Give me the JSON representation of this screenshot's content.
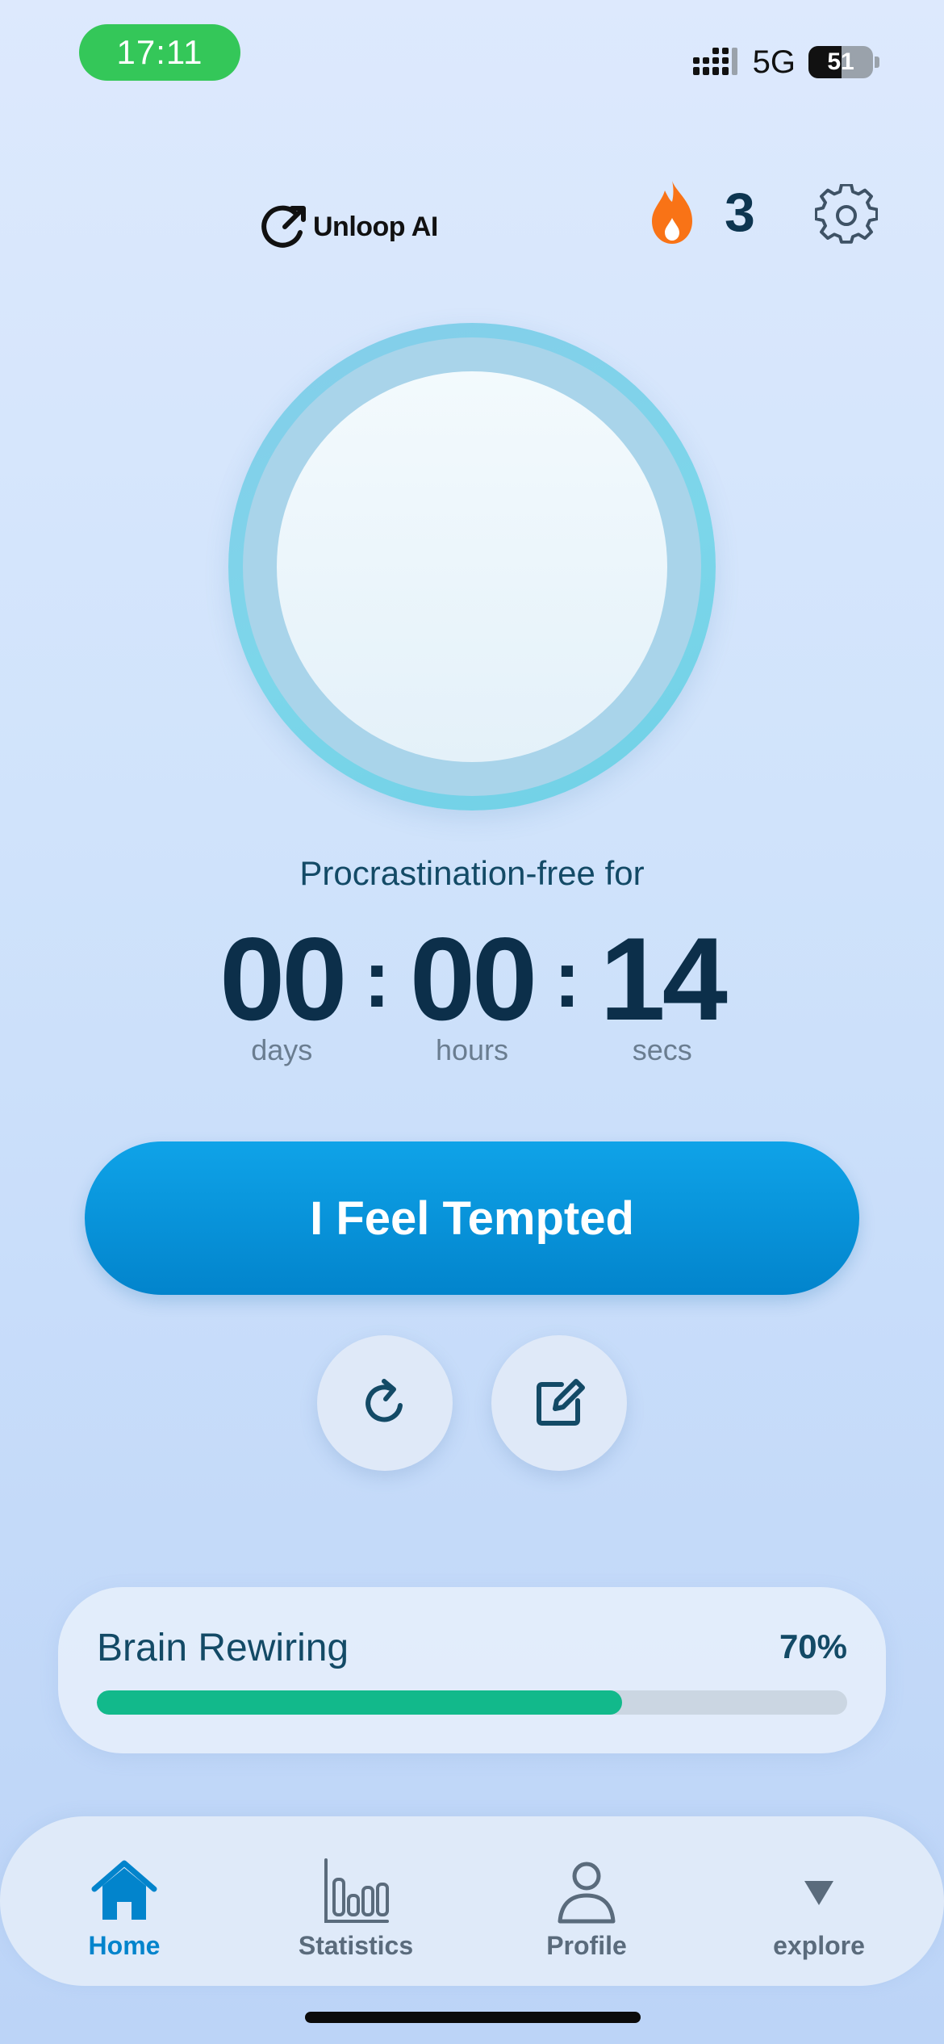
{
  "status_bar": {
    "time": "17:11",
    "network": "5G",
    "battery": "51"
  },
  "header": {
    "brand": "Unloop AI",
    "streak_count": "3"
  },
  "timer": {
    "subtitle": "Procrastination-free for",
    "days": "00",
    "hours": "00",
    "secs": "14",
    "days_label": "days",
    "hours_label": "hours",
    "secs_label": "secs",
    "separator": ":"
  },
  "actions": {
    "tempted_label": "I Feel Tempted"
  },
  "progress": {
    "title": "Brain Rewiring",
    "value_label": "70%",
    "fraction": 0.7,
    "color": "#12b98b"
  },
  "nav": {
    "items": [
      {
        "label": "Home",
        "icon": "home-icon",
        "active": true
      },
      {
        "label": "Statistics",
        "icon": "bar-chart-icon",
        "active": false
      },
      {
        "label": "Profile",
        "icon": "person-icon",
        "active": false
      },
      {
        "label": "explore",
        "icon": "triangle-down-icon",
        "active": false
      }
    ]
  },
  "colors": {
    "accent": "#0284cc",
    "status_pill": "#34c759",
    "flame": "#f97316"
  }
}
